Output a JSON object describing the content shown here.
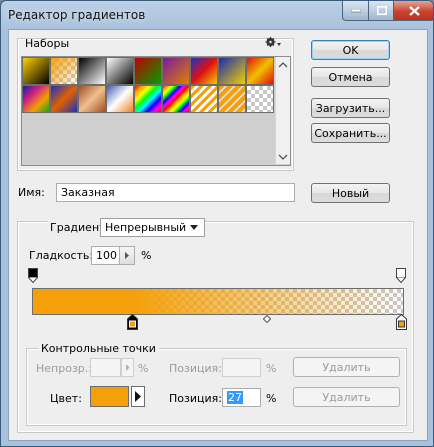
{
  "window": {
    "title": "Редактор градиентов"
  },
  "presets": {
    "label": "Наборы",
    "gear_icon": "gear-icon"
  },
  "buttons": {
    "ok": "OK",
    "cancel": "Отмена",
    "load": "Загрузить...",
    "save": "Сохранить...",
    "new": "Новый"
  },
  "name": {
    "label": "Имя:",
    "value": "Заказная"
  },
  "gradient": {
    "type_label": "Градиент:",
    "type_value": "Непрерывный",
    "smoothness_label": "Гладкость:",
    "smoothness_value": "100",
    "smoothness_unit": "%"
  },
  "stops": {
    "group_label": "Контрольные точки",
    "opacity_label": "Непрозр.:",
    "opacity_unit": "%",
    "opacity_position_label": "Позиция:",
    "opacity_position_unit": "%",
    "opacity_delete": "Удалить",
    "color_label": "Цвет:",
    "color_value": "#f5a00a",
    "color_position_label": "Позиция:",
    "color_position_value": "27",
    "color_position_unit": "%",
    "color_delete": "Удалить"
  },
  "colors": {
    "accent": "#f5a00a",
    "title_bar": "#a9c1dc",
    "dialog_bg": "#eeeeee",
    "selection": "#3399ff"
  }
}
